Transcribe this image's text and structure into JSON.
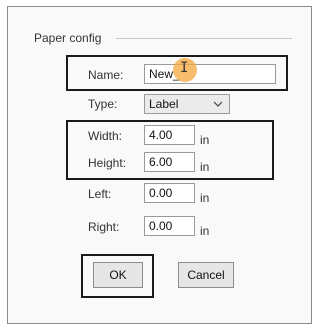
{
  "group": {
    "title": "Paper config"
  },
  "fields": {
    "name": {
      "label": "Name:",
      "value": "New_"
    },
    "type": {
      "label": "Type:",
      "value": "Label"
    },
    "width": {
      "label": "Width:",
      "value": "4.00",
      "unit": "in"
    },
    "height": {
      "label": "Height:",
      "value": "6.00",
      "unit": "in"
    },
    "left": {
      "label": "Left:",
      "value": "0.00",
      "unit": "in"
    },
    "right": {
      "label": "Right:",
      "value": "0.00",
      "unit": "in"
    }
  },
  "buttons": {
    "ok": "OK",
    "cancel": "Cancel"
  },
  "colors": {
    "highlight_box": "#1a1a1a",
    "cursor_highlight": "#f5a63c"
  },
  "icons": {
    "cursor": "ibeam-cursor-icon",
    "dropdown": "chevron-down-icon"
  }
}
